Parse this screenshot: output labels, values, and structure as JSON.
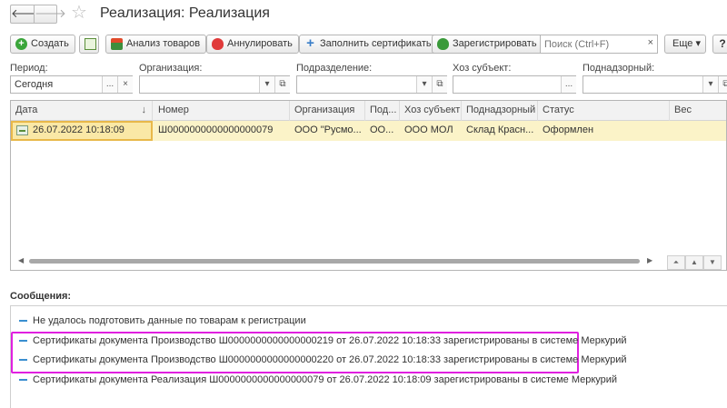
{
  "nav": {
    "back": "🡐",
    "forward": "🡒",
    "favorite": "☆"
  },
  "title": "Реализация: Реализация",
  "toolbar": {
    "create": "Создать",
    "analysis": "Анализ товаров",
    "cancel": "Аннулировать",
    "fill_certs": "Заполнить сертификаты",
    "register": "Зарегистрировать",
    "search_placeholder": "Поиск (Ctrl+F)",
    "clear": "×",
    "more": "Еще ▾",
    "help": "?"
  },
  "filters": {
    "period": {
      "label": "Период:",
      "value": "Сегодня"
    },
    "organization": {
      "label": "Организация:",
      "value": ""
    },
    "subdivision": {
      "label": "Подразделение:",
      "value": ""
    },
    "economic_entity": {
      "label": "Хоз субъект:",
      "value": ""
    },
    "supervised": {
      "label": "Поднадзорный:",
      "value": ""
    }
  },
  "grid": {
    "columns": [
      "Дата",
      "Номер",
      "Организация",
      "Под...",
      "Хоз субъект",
      "Поднадзорный",
      "Статус",
      "Вес"
    ],
    "sort_indicator": "↓",
    "rows": [
      {
        "date": "26.07.2022 10:18:09",
        "number": "Ш0000000000000000079",
        "organization": "ООО \"Русмо...",
        "subdivision": "ОО...",
        "economic_entity": "ООО  МОЛ",
        "supervised": "Склад Красн...",
        "status": "Оформлен",
        "weight": ""
      }
    ]
  },
  "messages": {
    "title": "Сообщения:",
    "items": [
      "Не удалось подготовить данные по товарам к регистрации",
      "Сертификаты документа Производство Ш0000000000000000219 от 26.07.2022 10:18:33 зарегистрированы в системе Меркурий",
      "Сертификаты документа Производство Ш0000000000000000220 от 26.07.2022 10:18:33 зарегистрированы в системе Меркурий",
      "Сертификаты документа Реализация Ш0000000000000000079 от 26.07.2022 10:18:09 зарегистрированы в системе Меркурий"
    ]
  },
  "colors": {
    "highlight": "#e020e0",
    "selected_row": "#fbf3c8",
    "accent": "#3a8fd0"
  }
}
